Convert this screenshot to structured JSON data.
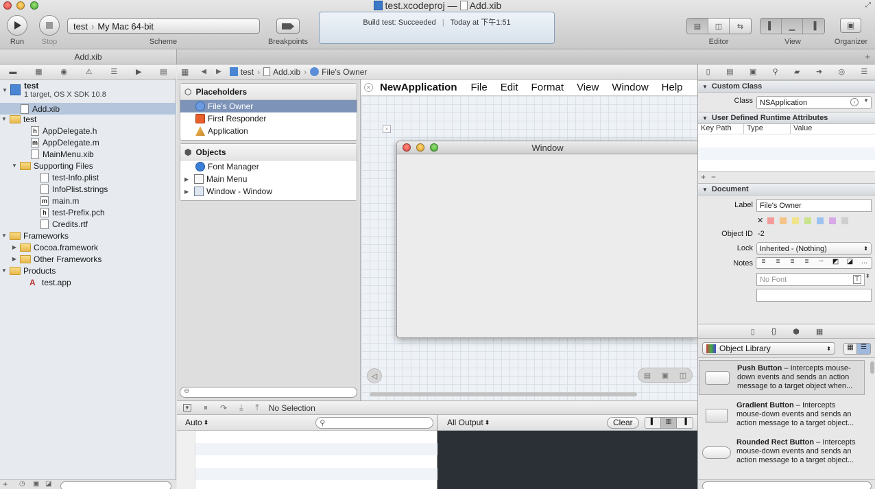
{
  "window": {
    "title_project": "test.xcodeproj",
    "title_sep": "—",
    "title_file": "Add.xib"
  },
  "toolbar": {
    "run_label": "Run",
    "stop_label": "Stop",
    "scheme_target": "test",
    "scheme_dest": "My Mac 64-bit",
    "scheme_label": "Scheme",
    "breakpoints_label": "Breakpoints",
    "activity_status": "Build test: Succeeded",
    "activity_time": "Today at 下午1:51",
    "editor_label": "Editor",
    "view_label": "View",
    "organizer_label": "Organizer"
  },
  "tab": {
    "label": "Add.xib"
  },
  "navigator": {
    "project_name": "test",
    "project_sub": "1 target, OS X SDK 10.8",
    "items": [
      {
        "label": "Add.xib",
        "icon": "xib-file-icon"
      },
      {
        "label": "test",
        "icon": "folder-icon"
      },
      {
        "label": "AppDelegate.h",
        "icon": "h"
      },
      {
        "label": "AppDelegate.m",
        "icon": "m"
      },
      {
        "label": "MainMenu.xib",
        "icon": "xib-file-icon"
      },
      {
        "label": "Supporting Files",
        "icon": "folder-icon"
      },
      {
        "label": "test-Info.plist",
        "icon": "plist-file-icon"
      },
      {
        "label": "InfoPlist.strings",
        "icon": "strings-file-icon"
      },
      {
        "label": "main.m",
        "icon": "m"
      },
      {
        "label": "test-Prefix.pch",
        "icon": "h"
      },
      {
        "label": "Credits.rtf",
        "icon": "rtf-file-icon"
      },
      {
        "label": "Frameworks",
        "icon": "folder-icon"
      },
      {
        "label": "Cocoa.framework",
        "icon": "framework-icon"
      },
      {
        "label": "Other Frameworks",
        "icon": "folder-icon"
      },
      {
        "label": "Products",
        "icon": "folder-icon"
      },
      {
        "label": "test.app",
        "icon": "app-icon"
      }
    ]
  },
  "jumpbar": {
    "crumb1": "test",
    "crumb2": "Add.xib",
    "crumb3": "File's Owner"
  },
  "outline": {
    "placeholders_title": "Placeholders",
    "placeholders": [
      "File's Owner",
      "First Responder",
      "Application"
    ],
    "objects_title": "Objects",
    "objects": [
      "Font Manager",
      "Main Menu",
      "Window - Window"
    ]
  },
  "canvas": {
    "menubar": [
      "NewApplication",
      "File",
      "Edit",
      "Format",
      "View",
      "Window",
      "Help"
    ],
    "window_title": "Window"
  },
  "debug": {
    "no_selection": "No Selection",
    "auto_label": "Auto",
    "all_output": "All Output",
    "clear_label": "Clear"
  },
  "inspector": {
    "custom_class_title": "Custom Class",
    "class_label": "Class",
    "class_value": "NSApplication",
    "udra_title": "User Defined Runtime Attributes",
    "col_keypath": "Key Path",
    "col_type": "Type",
    "col_value": "Value",
    "document_title": "Document",
    "label_label": "Label",
    "label_value": "File's Owner",
    "objectid_label": "Object ID",
    "objectid_value": "-2",
    "lock_label": "Lock",
    "lock_value": "Inherited - (Nothing)",
    "notes_label": "Notes",
    "font_placeholder": "No Font"
  },
  "library": {
    "selector": "Object Library",
    "items": [
      {
        "name": "Push Button",
        "desc": " – Intercepts mouse-down events and sends an action message to a target object when..."
      },
      {
        "name": "Gradient Button",
        "desc": " – Intercepts mouse-down events and sends an action message to a target object..."
      },
      {
        "name": "Rounded Rect Button",
        "desc": " – Intercepts mouse-down events and sends an action message to a target object..."
      }
    ]
  },
  "colors": {
    "selection": "#b5c6dc",
    "outline_selection": "#7d94b8",
    "console_bg": "#2b2f36"
  }
}
